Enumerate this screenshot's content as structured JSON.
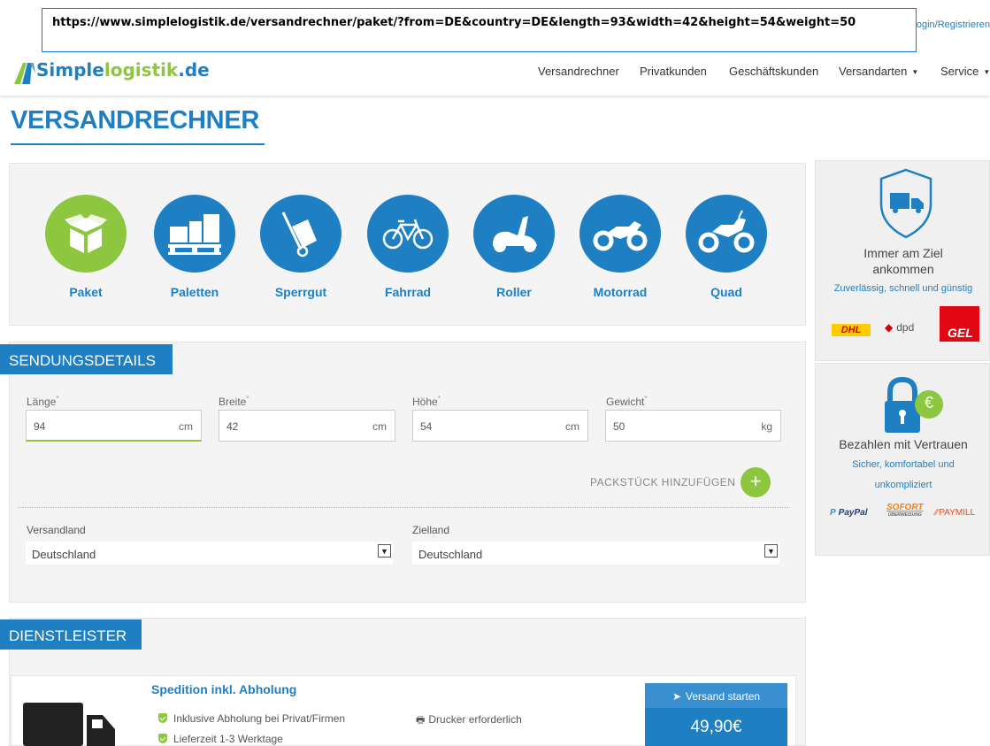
{
  "browser": {
    "url": "https://www.simplelogistik.de/versandrechner/paket/?from=DE&country=DE&length=93&width=42&height=54&weight=50"
  },
  "topbar": {
    "login": "ogin/Registrieren"
  },
  "header": {
    "logo_part1": "Simple",
    "logo_part2": "logistik",
    "logo_part3": ".de",
    "nav": [
      "Versandrechner",
      "Privatkunden",
      "Geschäftskunden",
      "Versandarten",
      "Service"
    ]
  },
  "page": {
    "title": "VERSANDRECHNER"
  },
  "vehicles": [
    "Paket",
    "Paletten",
    "Sperrgut",
    "Fahrrad",
    "Roller",
    "Motorrad",
    "Quad"
  ],
  "shipment": {
    "header": "SENDUNGSDETAILS",
    "fields": [
      {
        "label": "Länge",
        "value": "94",
        "unit": "cm"
      },
      {
        "label": "Breite",
        "value": "42",
        "unit": "cm"
      },
      {
        "label": "Höhe",
        "value": "54",
        "unit": "cm"
      },
      {
        "label": "Gewicht",
        "value": "50",
        "unit": "kg"
      }
    ],
    "required_mark": "*",
    "add_package": "PACKSTÜCK HINZUFÜGEN",
    "add_symbol": "+",
    "origin_label": "Versandland",
    "origin_value": "Deutschland",
    "dest_label": "Zielland",
    "dest_value": "Deutschland"
  },
  "providers": {
    "header": "DIENSTLEISTER",
    "service_title": "Spedition inkl. Abholung",
    "features": [
      "Inklusive Abholung bei Privat/Firmen",
      "Lieferzeit 1-3 Werktage"
    ],
    "printer": "Drucker erforderlich",
    "start_button": "Versand starten",
    "price": "49,90€"
  },
  "sidebar": {
    "box1_title_line1": "Immer am Ziel",
    "box1_title_line2": "ankommen",
    "box1_sub": "Zuverlässig, schnell und günstig",
    "carriers": [
      "DHL",
      "dpd",
      "GEL"
    ],
    "box2_title": "Bezahlen mit Vertrauen",
    "box2_sub_line1": "Sicher, komfortabel und",
    "box2_sub_line2": "unkompliziert",
    "payments": [
      "PayPal",
      "SOFORT",
      "ÜBERWEISUNG",
      "PAYMILL"
    ],
    "euro_symbol": "€"
  },
  "colors": {
    "brand_blue": "#1e7fc3",
    "brand_green": "#8dc63f"
  }
}
